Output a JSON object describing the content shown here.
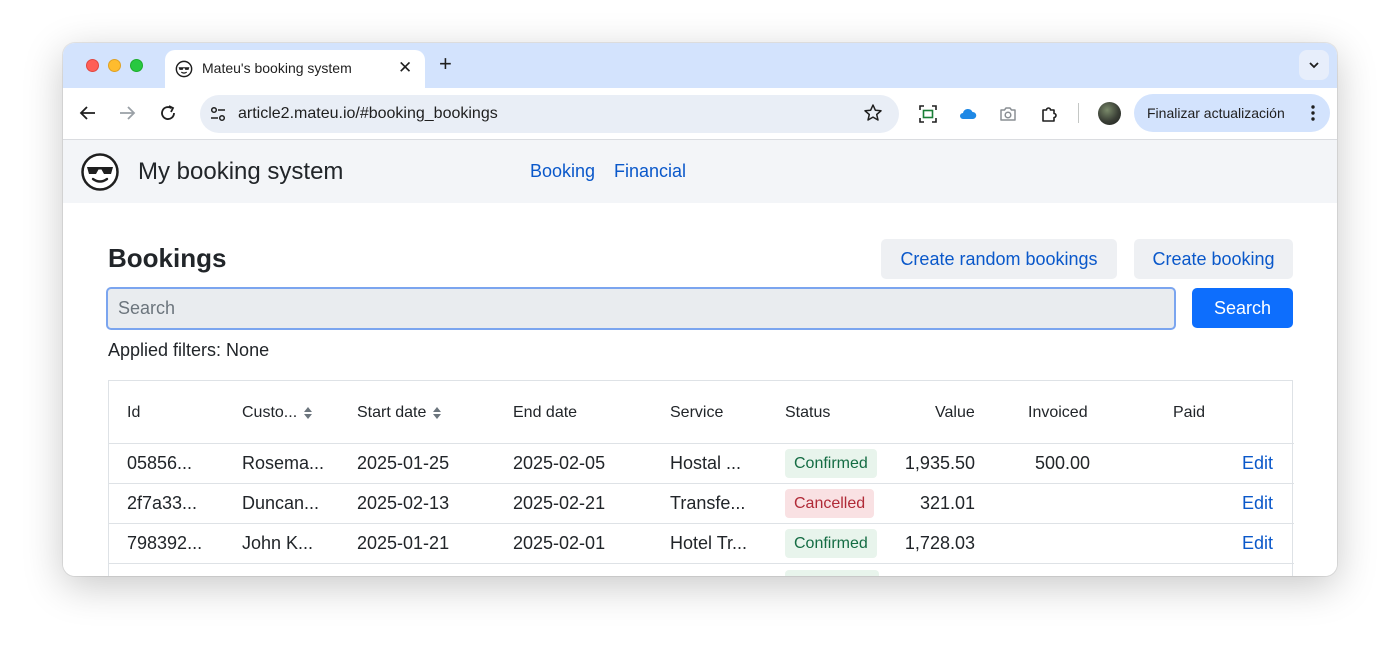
{
  "browser": {
    "tab_title": "Mateu's booking system",
    "url": "article2.mateu.io/#booking_bookings",
    "update_button": "Finalizar actualización"
  },
  "app": {
    "title": "My booking system",
    "nav": [
      "Booking",
      "Financial"
    ]
  },
  "page": {
    "heading": "Bookings",
    "create_random_label": "Create random bookings",
    "create_label": "Create booking",
    "search_placeholder": "Search",
    "search_button": "Search",
    "applied_filters": "Applied filters: None"
  },
  "table": {
    "columns": [
      "Id",
      "Custo...",
      "Start date",
      "End date",
      "Service",
      "Status",
      "Value",
      "Invoiced",
      "Paid"
    ],
    "edit_label": "Edit",
    "rows": [
      {
        "id": "05856...",
        "customer": "Rosema...",
        "start": "2025-01-25",
        "end": "2025-02-05",
        "service": "Hostal ...",
        "status": "Confirmed",
        "value": "1,935.50",
        "invoiced": "500.00",
        "paid": ""
      },
      {
        "id": "2f7a33...",
        "customer": "Duncan...",
        "start": "2025-02-13",
        "end": "2025-02-21",
        "service": "Transfe...",
        "status": "Cancelled",
        "value": "321.01",
        "invoiced": "",
        "paid": ""
      },
      {
        "id": "798392...",
        "customer": "John K...",
        "start": "2025-01-21",
        "end": "2025-02-01",
        "service": "Hotel Tr...",
        "status": "Confirmed",
        "value": "1,728.03",
        "invoiced": "",
        "paid": ""
      }
    ]
  },
  "colors": {
    "primary": "#0d6efd",
    "link": "#0a58ca",
    "confirmed_bg": "#e8f4ec",
    "cancelled_bg": "#f9e1e3"
  }
}
